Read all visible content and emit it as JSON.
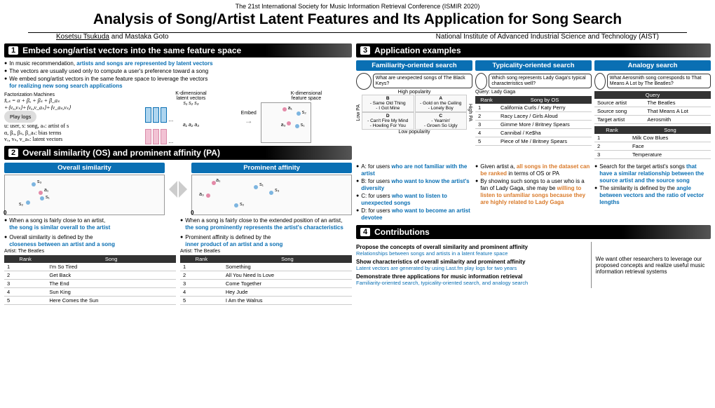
{
  "conf": "The 21st International Society for Music Information Retrieval Conference (ISMIR 2020)",
  "title": "Analysis of Song/Artist Latent Features and Its Application for Song Search",
  "author1": "Kosetsu Tsukuda",
  "author2": " and Mastaka Goto",
  "affil": "National Institute of Advanced Industrial Science and Technology (AIST)",
  "s1": {
    "hdr": "Embed song/artist vectors into the same feature space",
    "num": "1",
    "b1a": "In music recommendation, ",
    "b1b": "artists and songs are represented by latent vectors",
    "b2": "The vectors are usually used only to compute a user's preference toward a song",
    "b3a": "We embed song/artist vectors in the same feature space to leverage the vectors ",
    "b3b": "for realizing new song search applications",
    "fm": "Factorization Machines",
    "pl": "Play logs",
    "eq1": "x̂ᵤₛ = α + βᵤ + βₛ + β_aₛ",
    "eq2": "+⟨vᵤ,vₛ⟩+⟨vᵤ,v_aₛ⟩+⟨v_aₛ,vₛ⟩",
    "leg1": "u: user, s: song, aₛ: artist of s",
    "leg2": "α, βᵤ, βₛ, β_aₛ: bias terms",
    "leg3": "vᵤ, vₛ, v_aₛ: latent vectors",
    "kl": "K-dimensional",
    "lv": "latent vectors",
    "fs": "feature space",
    "em": "Embed"
  },
  "s2": {
    "hdr": "Overall similarity (OS) and prominent affinity (PA)",
    "num": "2",
    "os": "Overall similarity",
    "pa": "Prominent affinity",
    "os_b1a": "When a song is fairly close to an artist, ",
    "os_b1b": "the song is similar overall to the artist",
    "os_b2a": "Overall similarity is defined by the ",
    "os_b2b": "closeness between an artist and a song",
    "pa_b1a": "When a song is fairly close to the extended position of an artist, ",
    "pa_b1b": "the song prominently represents the artist's characteristics",
    "pa_b2a": "Prominent affinity is defined by the ",
    "pa_b2b": "inner product of an artist and a song",
    "art": "Artist: The Beatles",
    "rk": "Rank",
    "sg": "Song",
    "ost": [
      "I'm So Tired",
      "Get Back",
      "The End",
      "Sun King",
      "Here Comes the Sun"
    ],
    "pat": [
      "Something",
      "All You Need Is Love",
      "Come Together",
      "Hey Jude",
      "I Am the Walrus"
    ]
  },
  "s3": {
    "hdr": "Application examples",
    "num": "3",
    "h1": "Familiarity-oriented search",
    "h2": "Typicality-oriented search",
    "h3": "Analogy search",
    "q1": "What are unexpected songs of The Black Keys?",
    "q2": "Which song represents Lady Gaga's typical characteristics well?",
    "q3": "What Aerosmith song corresponds to That Means A Lot by The Beatles?",
    "hp": "High popularity",
    "lp": "Low popularity",
    "lowpa": "Low PA",
    "highpa": "High PA",
    "qb": {
      "B": [
        "- Same Old Thing",
        "- I Got Mine"
      ],
      "A": [
        "- Gold on the Ceiling",
        "- Lonely Boy"
      ],
      "D": [
        "- Can't Fire My Mind",
        "- Howling For You"
      ],
      "C": [
        "- Yearnin'",
        "- Grown So Ugly"
      ]
    },
    "ql": "Query: Lady Gaga",
    "sos": "Song by OS",
    "tt": [
      "California Curls / Katy Perry",
      "Racy Lacey / Girls Aloud",
      "Gimme More / Britney Spears",
      "Cannibal / Ke$ha",
      "Piece of Me / Britney Spears"
    ],
    "qy": "Query",
    "sa": "Source artist",
    "sav": "The Beatles",
    "ss": "Source song",
    "ssv": "That Means A Lot",
    "ta": "Target artist",
    "tav": "Aerosmith",
    "at": [
      "Milk Cow Blues",
      "Face",
      "Temperature"
    ],
    "fa": {
      "a1": "A: for users ",
      "a2": "who are not familiar with the artist",
      "b1": "B: for users ",
      "b2": "who want to know the artist's diversity",
      "c1": "C: for users ",
      "c2": "who want to listen to unexpected songs",
      "d1": "D: for users ",
      "d2": "who want to become an artist devotee"
    },
    "ty": {
      "a1": "Given artist a, ",
      "a2": "all songs in the dataset can be ranked ",
      "a3": "in terms of OS or PA",
      "b1": "By showing such songs to a user who is a fan of Lady Gaga, she may be ",
      "b2": "willing to listen to unfamiliar songs because they are highly related to Lady Gaga"
    },
    "an": {
      "a1": "Search for the target artist's songs ",
      "a2": "that have a similar relationship between the source artist and the source song",
      "b1": "The similarity is defined by the ",
      "b2": "angle between vectors and the ratio of vector lengths"
    }
  },
  "s4": {
    "hdr": "Contributions",
    "num": "4",
    "c1t": "Propose the concepts of overall similarity and prominent affinity",
    "c1d": "Relationships between songs and artists in a latent feature space",
    "c2t": "Show characteristics of overall similarity and prominent affinity",
    "c2d": "Latent vectors are generated by using Last.fm play logs for two years",
    "c3t": "Demonstrate three applications for music information retrieval",
    "c3d": "Familiarity-oriented search, typicality-oriented search, and analogy search",
    "side": "We want other researchers to leverage our proposed concepts and realize useful music information retrieval systems"
  }
}
